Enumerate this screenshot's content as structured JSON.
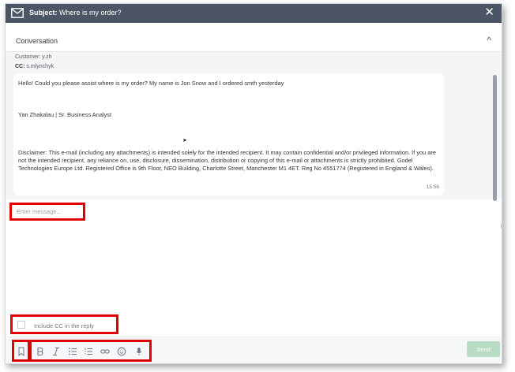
{
  "header": {
    "subject_label": "Subject:",
    "subject_value": "Where is my order?",
    "close_symbol": "✕",
    "icons": {
      "left": "mail-icon",
      "right": "close-icon"
    }
  },
  "conversation": {
    "section_title": "Conversation",
    "collapse_symbol": "^",
    "customer_line": "Customer: y.zh",
    "cc_label": "CC:",
    "cc_value": "s.mlynchyk",
    "message": {
      "greeting": "Hello! Could you please assist where is my order? My name is Jon Snow and I ordered smth yesterday",
      "signature": "Yan Zhakalau | Sr. Business Analyst",
      "disclaimer": "Disclaimer: This e-mail (including any attachments) is intended solely for the intended recipient. It may contain confidential and/or privileged information. If you are not the intended recipient, any reliance on, use, disclosure, dissemination, distribution or copying of this e-mail or attachments is strictly prohibited. Godel Technologies Europe Ltd. Registered Office is 9th Floor, NEO Building, Charlotte Street, Manchester M1 4ET. Reg No 4551774 (Registered in England & Wales).",
      "time": "15:56"
    }
  },
  "composer": {
    "placeholder": "Enter message...",
    "include_cc_label": "Include CC in the reply",
    "send_label": "Send",
    "toolbar_icons": [
      "bookmark-icon",
      "bold-icon",
      "italic-icon",
      "bulleted-list-icon",
      "numbered-list-icon",
      "link-icon",
      "emoji-icon",
      "microphone-icon"
    ]
  },
  "colors": {
    "title_bar": "#4b5565",
    "highlight_border": "#e00000",
    "send_button": "#b9dcc5"
  }
}
